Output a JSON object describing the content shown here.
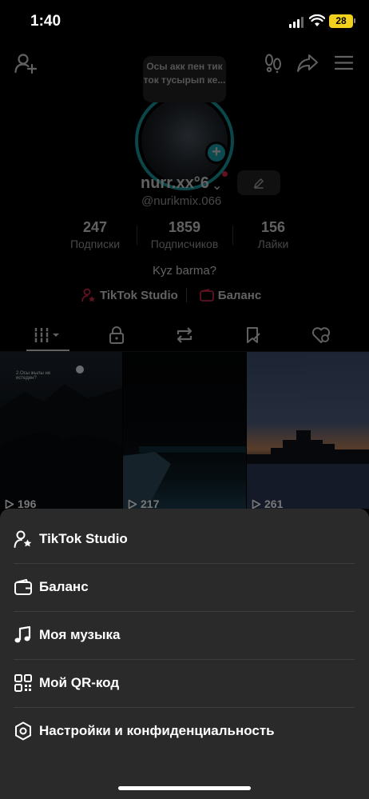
{
  "status": {
    "time": "1:40",
    "battery": "28"
  },
  "header": {
    "tooltip": "Осы акк пен тик ток тусырып ке...",
    "username": "nurr.xx°6",
    "handle": "@nurikmix.066"
  },
  "stats": [
    {
      "value": "247",
      "label": "Подписки"
    },
    {
      "value": "1859",
      "label": "Подписчиков"
    },
    {
      "value": "156",
      "label": "Лайки"
    }
  ],
  "bio": "Kyz barma?",
  "links": {
    "studio": "TikTok Studio",
    "balance": "Баланс"
  },
  "videos": [
    {
      "views": "196",
      "caption": "2.Осы жылы не истедин?"
    },
    {
      "views": "217"
    },
    {
      "views": "261"
    }
  ],
  "menu": [
    {
      "label": "TikTok Studio",
      "icon": "person-star-icon"
    },
    {
      "label": "Баланс",
      "icon": "wallet-icon"
    },
    {
      "label": "Моя музыка",
      "icon": "music-note-icon"
    },
    {
      "label": "Мой QR-код",
      "icon": "qr-code-icon"
    },
    {
      "label": "Настройки и конфиденциальность",
      "icon": "settings-gear-icon"
    }
  ],
  "colors": {
    "accent": "#1fb7c1",
    "battery": "#f1d01e",
    "sheet": "#2a2a2a",
    "studio_icon": "#ff2f55"
  }
}
